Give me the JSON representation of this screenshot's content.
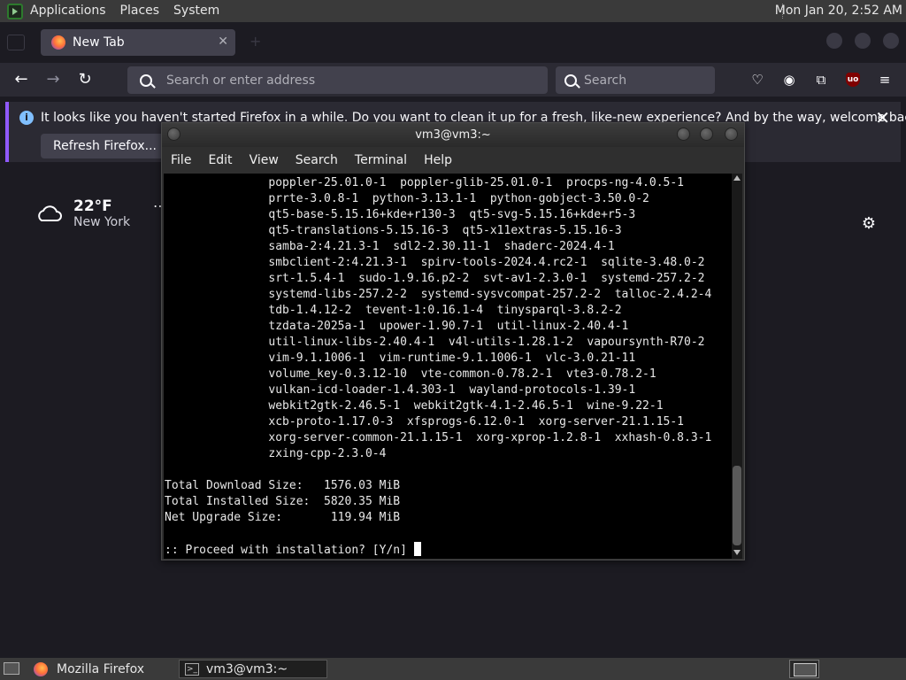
{
  "top_panel": {
    "menus": [
      "Applications",
      "Places",
      "System"
    ],
    "clock": "Mon Jan 20,  2:52 AM"
  },
  "firefox": {
    "tab_title": "New Tab",
    "url_placeholder": "Search or enter address",
    "search_placeholder": "Search",
    "notification": {
      "message": "It looks like you haven't started Firefox in a while. Do you want to clean it up for a fresh, like-new experience? And by the way, welcome back!",
      "button": "Refresh Firefox..."
    },
    "weather": {
      "temp": "22°F",
      "city": "New York"
    }
  },
  "terminal": {
    "title": "vm3@vm3:~",
    "menu": [
      "File",
      "Edit",
      "View",
      "Search",
      "Terminal",
      "Help"
    ],
    "lines": [
      "               poppler-25.01.0-1  poppler-glib-25.01.0-1  procps-ng-4.0.5-1",
      "               prrte-3.0.8-1  python-3.13.1-1  python-gobject-3.50.0-2",
      "               qt5-base-5.15.16+kde+r130-3  qt5-svg-5.15.16+kde+r5-3",
      "               qt5-translations-5.15.16-3  qt5-x11extras-5.15.16-3",
      "               samba-2:4.21.3-1  sdl2-2.30.11-1  shaderc-2024.4-1",
      "               smbclient-2:4.21.3-1  spirv-tools-2024.4.rc2-1  sqlite-3.48.0-2",
      "               srt-1.5.4-1  sudo-1.9.16.p2-2  svt-av1-2.3.0-1  systemd-257.2-2",
      "               systemd-libs-257.2-2  systemd-sysvcompat-257.2-2  talloc-2.4.2-4",
      "               tdb-1.4.12-2  tevent-1:0.16.1-4  tinysparql-3.8.2-2",
      "               tzdata-2025a-1  upower-1.90.7-1  util-linux-2.40.4-1",
      "               util-linux-libs-2.40.4-1  v4l-utils-1.28.1-2  vapoursynth-R70-2",
      "               vim-9.1.1006-1  vim-runtime-9.1.1006-1  vlc-3.0.21-11",
      "               volume_key-0.3.12-10  vte-common-0.78.2-1  vte3-0.78.2-1",
      "               vulkan-icd-loader-1.4.303-1  wayland-protocols-1.39-1",
      "               webkit2gtk-2.46.5-1  webkit2gtk-4.1-2.46.5-1  wine-9.22-1",
      "               xcb-proto-1.17.0-3  xfsprogs-6.12.0-1  xorg-server-21.1.15-1",
      "               xorg-server-common-21.1.15-1  xorg-xprop-1.2.8-1  xxhash-0.8.3-1",
      "               zxing-cpp-2.3.0-4",
      "",
      "Total Download Size:   1576.03 MiB",
      "Total Installed Size:  5820.35 MiB",
      "Net Upgrade Size:       119.94 MiB",
      ""
    ],
    "prompt": ":: Proceed with installation? [Y/n] "
  },
  "taskbar": {
    "tasks": [
      "Mozilla Firefox",
      "vm3@vm3:~"
    ]
  }
}
